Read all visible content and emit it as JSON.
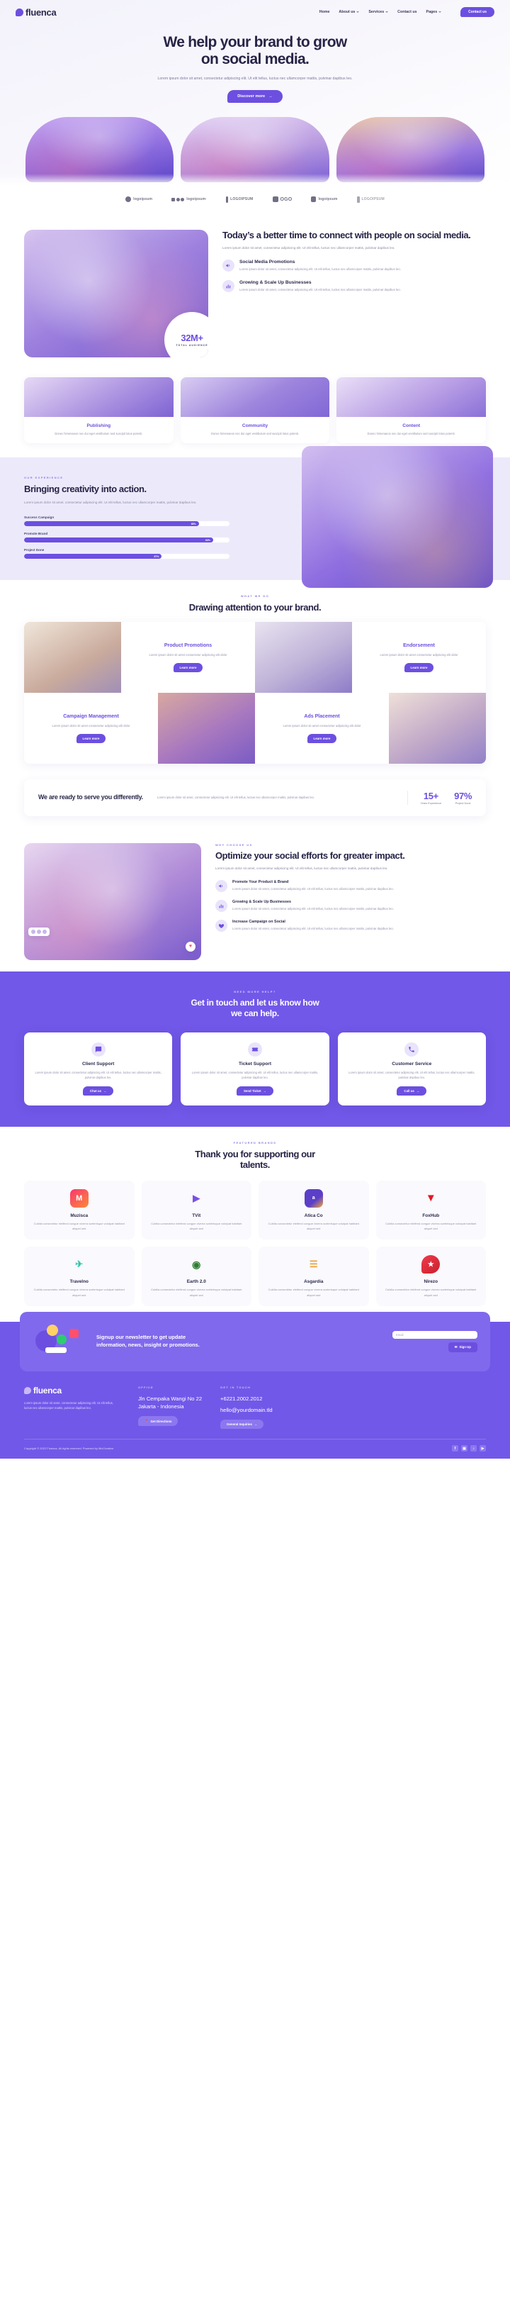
{
  "brand": {
    "name": "fluenca",
    "accent": "#6c4fe0",
    "dark": "#262346"
  },
  "nav": {
    "links": [
      {
        "label": "Home",
        "caret": false
      },
      {
        "label": "About us",
        "caret": true
      },
      {
        "label": "Services",
        "caret": true
      },
      {
        "label": "Contact us",
        "caret": false
      },
      {
        "label": "Pages",
        "caret": true
      }
    ],
    "cta": "Contact us"
  },
  "hero": {
    "title_line1": "We help your brand to grow",
    "title_line2": "on social media.",
    "paragraph": "Lorem ipsum dolor sit amet, consectetur adipiscing elit. Ut elit tellus, luctus nec ullamcorper mattis, pulvinar dapibus leo.",
    "button": "Discover more",
    "arrow": "→"
  },
  "logos": [
    {
      "text": "logoipsum",
      "mark": "stack"
    },
    {
      "text": "logoipsum·",
      "mark": "dots"
    },
    {
      "text": "LOGOIPSUM",
      "mark": "bars"
    },
    {
      "text": "OGO",
      "mark": "square"
    },
    {
      "text": "logoipsum",
      "mark": "tag"
    },
    {
      "text": "LOGOIPSUM",
      "mark": "fan"
    }
  ],
  "today": {
    "title": "Today’s a better time to connect with people on social media.",
    "paragraph": "Lorem ipsum dolor sit amet, consectetur adipiscing elit. Ut elit tellus, luctus nec ullamcorper mattis, pulvinar dapibus leo.",
    "stat_number": "32M+",
    "stat_caption": "TOTAL AUDIENCE",
    "features": [
      {
        "icon": "megaphone-icon",
        "title": "Social Media Promotions",
        "text": "Lorem ipsum dolor sit amet, consectetur adipiscing elit. Ut elit tellus, luctus nec ullamcorper mattis, pulvinar dapibus leo."
      },
      {
        "icon": "bar-chart-icon",
        "title": "Growing & Scale Up Businesses",
        "text": "Lorem ipsum dolor sit amet, consectetur adipiscing elit. Ut elit tellus, luctus nec ullamcorper mattis, pulvinar dapibus leo."
      }
    ]
  },
  "cards3": [
    {
      "title": "Publishing",
      "text": "Donec himenaeos nec dui eget vestibulum sed suscipit lotus potenti."
    },
    {
      "title": "Community",
      "text": "Donec himenaeos nec dui eget vestibulum sed suscipit lotus potenti."
    },
    {
      "title": "Content",
      "text": "Donec himenaeos nec dui eget vestibulum sed suscipit lotus potenti."
    }
  ],
  "experience": {
    "eyebrow": "OUR EXPERIENCE",
    "title": "Bringing creativity into action.",
    "paragraph": "Lorem ipsum dolor sit amet, consectetur adipiscing elit. Ut elit tellus, luctus nec ullamcorper mattis, pulvinar dapibus leo.",
    "bars": [
      {
        "label": "Success Campaign",
        "value": 85,
        "display": "85%"
      },
      {
        "label": "Promote Brand",
        "value": 92,
        "display": "92%"
      },
      {
        "label": "Project Done",
        "value": 67,
        "display": "67%"
      }
    ]
  },
  "whatwedo": {
    "eyebrow": "WHAT WE DO",
    "title": "Drawing attention to your brand.",
    "items": [
      {
        "title": "Product Promotions",
        "text": "Lorem ipsum dolor sit amet consectetur adipiscing elit dolor",
        "button": "Learn more"
      },
      {
        "title": "Endorsement",
        "text": "Lorem ipsum dolor sit amet consectetur adipiscing elit dolor",
        "button": "Learn more"
      },
      {
        "title": "Campaign Management",
        "text": "Lorem ipsum dolor sit amet consectetur adipiscing elit dolor",
        "button": "Learn more"
      },
      {
        "title": "Ads Placement",
        "text": "Lorem ipsum dolor sit amet consectetur adipiscing elit dolor",
        "button": "Learn more"
      }
    ]
  },
  "ready": {
    "title": "We are ready to serve you differently.",
    "paragraph": "Lorem ipsum dolor sit amet, consectetur adipiscing elit. Ut elit tellus, luctus nec ullamcorper mattis, pulvinar dapibus leo.",
    "stats": [
      {
        "number": "15+",
        "label": "Years Experience"
      },
      {
        "number": "97%",
        "label": "Project Done"
      }
    ]
  },
  "why": {
    "eyebrow": "WHY CHOOSE US",
    "title": "Optimize your social efforts for greater impact.",
    "paragraph": "Lorem ipsum dolor sit amet, consectetur adipiscing elit. Ut elit tellus, luctus nec ullamcorper mattis, pulvinar dapibus leo.",
    "features": [
      {
        "icon": "megaphone-icon",
        "title": "Promote Your Product & Brand",
        "text": "Lorem ipsum dolor sit amet, consectetur adipiscing elit. Ut elit tellus, luctus nec ullamcorper mattis, pulvinar dapibus leo."
      },
      {
        "icon": "bar-chart-icon",
        "title": "Growing & Scale Up Businesses",
        "text": "Lorem ipsum dolor sit amet, consectetur adipiscing elit. Ut elit tellus, luctus nec ullamcorper mattis, pulvinar dapibus leo."
      },
      {
        "icon": "heart-icon",
        "title": "Increase Campaign on Social",
        "text": "Lorem ipsum dolor sit amet, consectetur adipiscing elit. Ut elit tellus, luctus nec ullamcorper mattis, pulvinar dapibus leo."
      }
    ]
  },
  "contact": {
    "eyebrow": "NEED MORE HELP?",
    "title_line1": "Get in touch and let us know how",
    "title_line2": "we can help.",
    "cards": [
      {
        "icon": "chat-icon",
        "title": "Client Support",
        "text": "Lorem ipsum dolor sit amet, consectetur adipiscing elit. Ut elit tellus, luctus nec ullamcorper mattis, pulvinar dapibus leo.",
        "button": "Chat us"
      },
      {
        "icon": "ticket-icon",
        "title": "Ticket Support",
        "text": "Lorem ipsum dolor sit amet, consectetur adipiscing elit. Ut elit tellus, luctus nec ullamcorper mattis, pulvinar dapibus leo.",
        "button": "Send Ticket"
      },
      {
        "icon": "phone-icon",
        "title": "Customer Service",
        "text": "Lorem ipsum dolor sit amet, consectetur adipiscing elit. Ut elit tellus, luctus nec ullamcorper mattis, pulvinar dapibus leo.",
        "button": "Call us"
      }
    ]
  },
  "featured": {
    "eyebrow": "FEATURED BRANDS",
    "title_line1": "Thank you for supporting our",
    "title_line2": "talents.",
    "brands": [
      {
        "name": "Muzisca",
        "glyph": "M",
        "color1": "#f9376e",
        "color2": "#fc8a3a",
        "text": "Cubilia consectetur eleifend congue viverra scelerisque volutpat habitant aliquet sed"
      },
      {
        "name": "TVit",
        "glyph": "▶",
        "color1": "#8b5cf6",
        "color2": "#6c4fe0",
        "text": "Cubilia consectetur eleifend congue viverra scelerisque volutpat habitant aliquet sed"
      },
      {
        "name": "Atica Co",
        "glyph": "a",
        "color1": "#5b3fc8",
        "color2": "#f4a93c",
        "text": "Cubilia consectetur eleifend congue viverra scelerisque volutpat habitant aliquet sed"
      },
      {
        "name": "FoxHub",
        "glyph": "▼",
        "color1": "#e4181f",
        "color2": "#b00f14",
        "text": "Cubilia consectetur eleifend congue viverra scelerisque volutpat habitant aliquet sed"
      },
      {
        "name": "Travelno",
        "glyph": "✈",
        "color1": "#2ec4a6",
        "color2": "#1aa88c",
        "text": "Cubilia consectetur eleifend congue viverra scelerisque volutpat habitant aliquet sed"
      },
      {
        "name": "Earth 2.0",
        "glyph": "◉",
        "color1": "#2e7d32",
        "color2": "#4caf50",
        "text": "Cubilia consectetur eleifend congue viverra scelerisque volutpat habitant aliquet sed"
      },
      {
        "name": "Asgardia",
        "glyph": "☰",
        "color1": "#e8a33d",
        "color2": "#c98322",
        "text": "Cubilia consectetur eleifend congue viverra scelerisque volutpat habitant aliquet sed"
      },
      {
        "name": "Nirezo",
        "glyph": "★",
        "color1": "#ef3b4b",
        "color2": "#c9202f",
        "text": "Cubilia consectetur eleifend congue viverra scelerisque volutpat habitant aliquet sed"
      }
    ]
  },
  "newsletter": {
    "headline_line1": "Signup our newsletter to get update",
    "headline_line2": "information, news, insight or promotions.",
    "input_placeholder": "Email",
    "button": "Sign Up",
    "button_icon": "✉"
  },
  "footer": {
    "logo": "fluenca",
    "about": "Lorem ipsum dolor sit amet, consectetur adipiscing elit. Ut elit tellus, luctus nec ullamcorper mattis, pulvinar dapibus leo.",
    "office_head": "OFFICE",
    "address_line1": "Jln Cempaka Wangi No 22",
    "address_line2": "Jakarta - Indonesia",
    "directions_button": "Get Directions",
    "directions_icon": "📍",
    "touch_head": "GET IN TOUCH",
    "phone": "+6221.2002.2012",
    "email": "hello@yourdomain.tld",
    "inquiries_button": "General Inquiries",
    "inquiries_arrow": "→",
    "copyright": "Copyright © 2022 Fluenca. All rights reserved. Powered by MixCreative.",
    "socials": [
      {
        "name": "facebook-icon",
        "glyph": "f"
      },
      {
        "name": "instagram-icon",
        "glyph": "▣"
      },
      {
        "name": "tiktok-icon",
        "glyph": "♪"
      },
      {
        "name": "youtube-icon",
        "glyph": "▶"
      }
    ]
  }
}
